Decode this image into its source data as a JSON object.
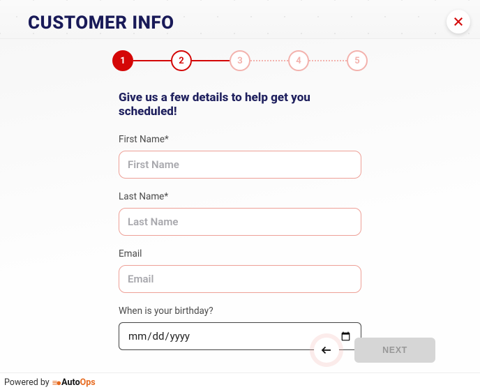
{
  "header": {
    "title": "CUSTOMER INFO"
  },
  "stepper": {
    "steps": [
      "1",
      "2",
      "3",
      "4",
      "5"
    ],
    "current": 2
  },
  "form": {
    "subtitle": "Give us a few details to help get you scheduled!",
    "first_name": {
      "label": "First Name*",
      "placeholder": "First Name",
      "value": ""
    },
    "last_name": {
      "label": "Last Name*",
      "placeholder": "Last Name",
      "value": ""
    },
    "email": {
      "label": "Email",
      "placeholder": "Email",
      "value": ""
    },
    "birthday": {
      "label": "When is your birthday?",
      "placeholder": "mm/dd/yyyy",
      "value": ""
    }
  },
  "actions": {
    "next_label": "NEXT"
  },
  "footer": {
    "powered_by": "Powered by",
    "brand_auto": "Auto",
    "brand_ops": "Ops"
  }
}
